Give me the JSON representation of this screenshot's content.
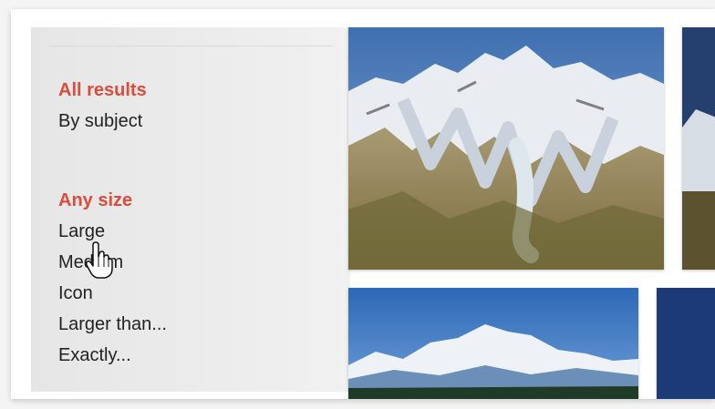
{
  "filters": {
    "type_group": {
      "selected": "All results",
      "options": [
        "By subject"
      ]
    },
    "size_group": {
      "selected": "Any size",
      "options": [
        "Large",
        "Medium",
        "Icon",
        "Larger than...",
        "Exactly..."
      ]
    }
  },
  "results": {
    "images": [
      {
        "icon": "mountain-range-painting-thumbnail"
      },
      {
        "icon": "partial-image-thumbnail"
      },
      {
        "icon": "snowy-mountain-photo-thumbnail"
      },
      {
        "icon": "partial-image-thumbnail"
      }
    ]
  },
  "cursor": {
    "icon": "hand-pointer-cursor"
  },
  "colors": {
    "accent": "#dd4b39",
    "text": "#222222",
    "sidebar_bg": "#e8e8e8"
  }
}
